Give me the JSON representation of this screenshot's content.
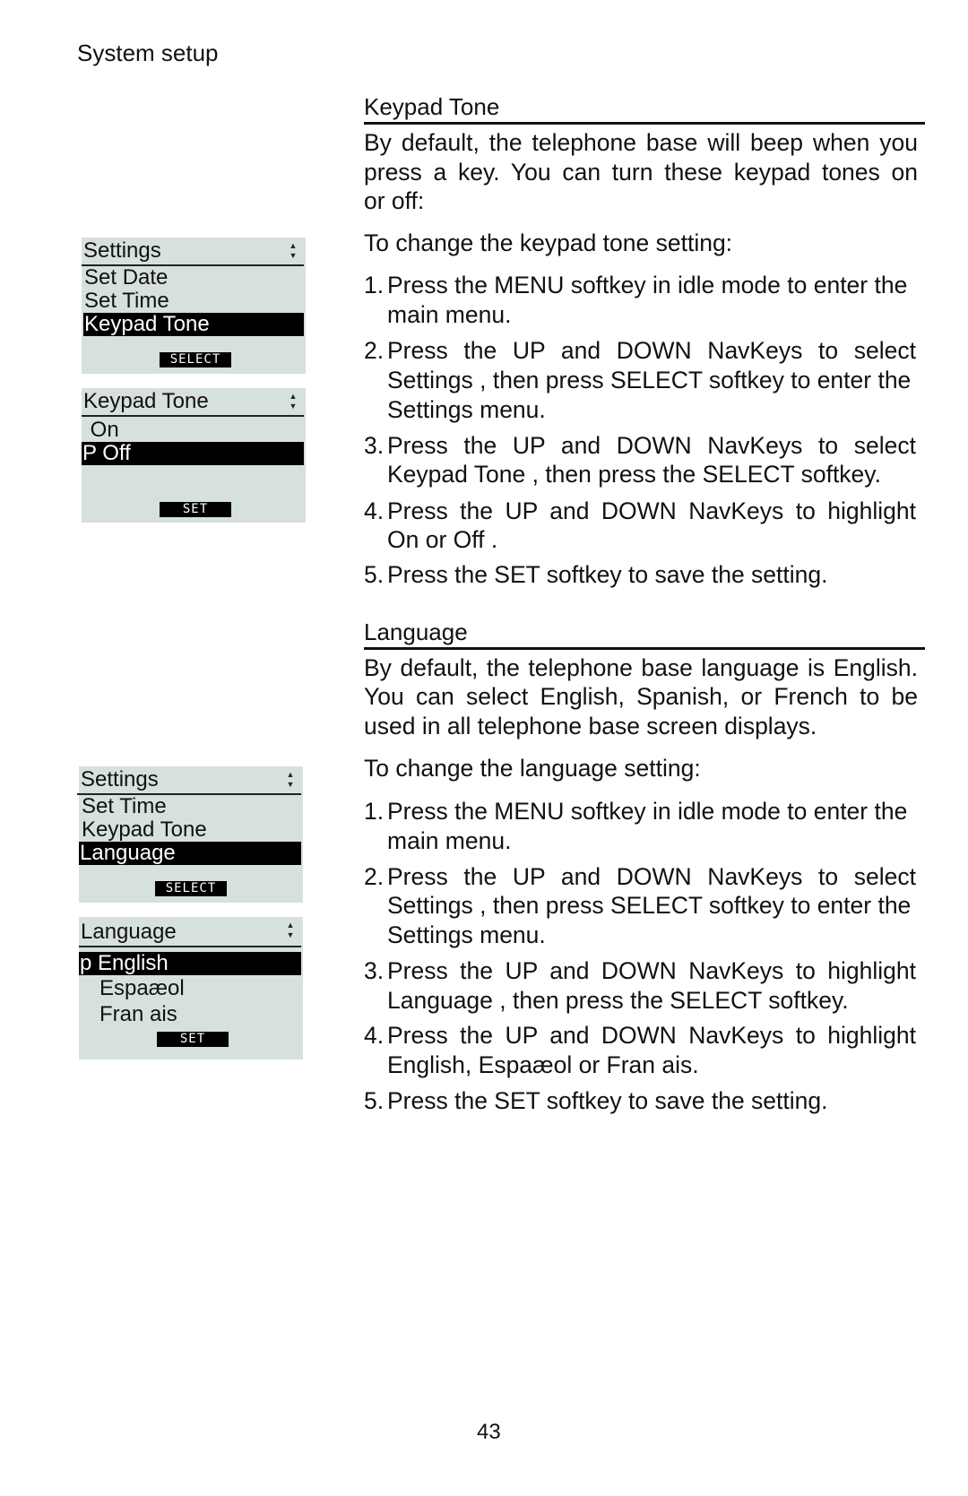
{
  "header": {
    "section": "System setup"
  },
  "keypad_tone": {
    "heading": "Keypad Tone",
    "intro_lines": [
      "By default, the telephone base will beep when you",
      "press a key. You can turn these keypad tones on",
      "or off:"
    ],
    "lead": "To change the keypad tone setting:",
    "steps": [
      {
        "num": "1.",
        "lines": [
          "Press the MENU softkey in idle mode to enter the",
          "main menu."
        ]
      },
      {
        "num": "2.",
        "lines": [
          "Press the UP and DOWN NavKeys to select",
          "Settings , then press SELECT softkey to enter the",
          "Settings  menu."
        ]
      },
      {
        "num": "3.",
        "lines": [
          "Press the UP and DOWN NavKeys to select",
          "Keypad Tone , then press the  SELECT softkey."
        ]
      },
      {
        "num": "4.",
        "lines": [
          "Press the UP and DOWN NavKeys to highlight",
          "On or Off ."
        ]
      },
      {
        "num": "5.",
        "lines": [
          "Press the SET softkey to save the setting."
        ]
      }
    ],
    "screens": [
      {
        "title": "Settings",
        "items": [
          "Set Date",
          "Set Time",
          "Keypad Tone"
        ],
        "selected_index": 2,
        "softkey": "SELECT"
      },
      {
        "title": "Keypad Tone",
        "items": [
          " On",
          "P Off"
        ],
        "selected_index": 1,
        "softkey": "SET"
      }
    ]
  },
  "language": {
    "heading": "Language",
    "intro_lines": [
      "By default, the telephone base language is English.",
      "You can select English, Spanish, or French to be",
      "used in all telephone base screen displays."
    ],
    "lead": "To change the language setting:",
    "steps": [
      {
        "num": "1.",
        "lines": [
          "Press the MENU softkey in idle mode to enter the",
          "main menu."
        ]
      },
      {
        "num": "2.",
        "lines": [
          "Press the UP and DOWN NavKeys to select",
          "Settings , then press SELECT softkey to enter the",
          "Settings  menu."
        ]
      },
      {
        "num": "3.",
        "lines": [
          "Press the UP and DOWN NavKeys to highlight",
          "Language , then press the  SELECT softkey."
        ]
      },
      {
        "num": "4.",
        "lines": [
          "Press the UP and DOWN NavKeys to highlight",
          "English, Espaæol or  Fran ais."
        ]
      },
      {
        "num": "5.",
        "lines": [
          "Press the SET softkey to save the setting."
        ]
      }
    ],
    "screens": [
      {
        "title": "Settings",
        "items": [
          "Set Time",
          "Keypad Tone",
          "Language"
        ],
        "selected_index": 2,
        "softkey": "SELECT"
      },
      {
        "title": "Language",
        "items": [
          "p English",
          "   Espaæol",
          "   Fran ais"
        ],
        "selected_index": 0,
        "softkey": "SET"
      }
    ]
  },
  "icons": {
    "scroll": "up-down-arrows-icon"
  },
  "footer": {
    "page_number": "43"
  }
}
